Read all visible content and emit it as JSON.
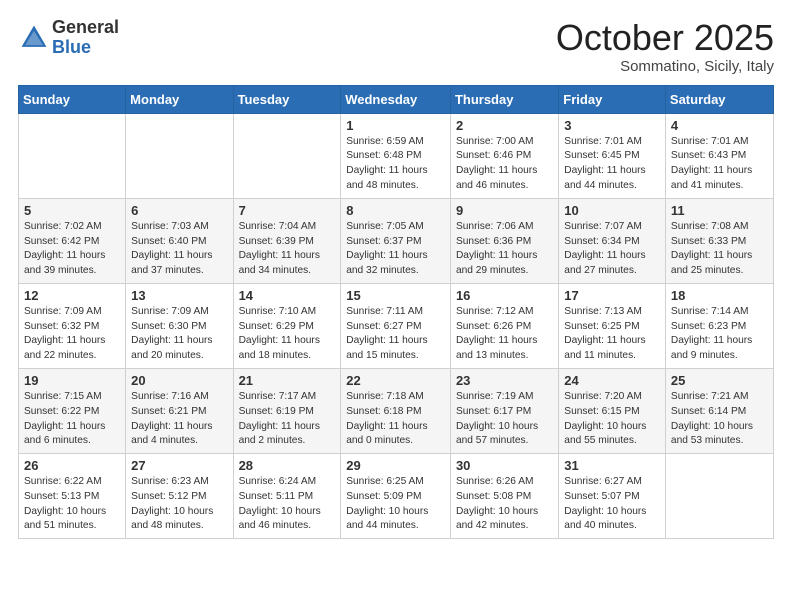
{
  "logo": {
    "general": "General",
    "blue": "Blue"
  },
  "header": {
    "month": "October 2025",
    "location": "Sommatino, Sicily, Italy"
  },
  "weekdays": [
    "Sunday",
    "Monday",
    "Tuesday",
    "Wednesday",
    "Thursday",
    "Friday",
    "Saturday"
  ],
  "weeks": [
    [
      {
        "day": "",
        "info": ""
      },
      {
        "day": "",
        "info": ""
      },
      {
        "day": "",
        "info": ""
      },
      {
        "day": "1",
        "info": "Sunrise: 6:59 AM\nSunset: 6:48 PM\nDaylight: 11 hours\nand 48 minutes."
      },
      {
        "day": "2",
        "info": "Sunrise: 7:00 AM\nSunset: 6:46 PM\nDaylight: 11 hours\nand 46 minutes."
      },
      {
        "day": "3",
        "info": "Sunrise: 7:01 AM\nSunset: 6:45 PM\nDaylight: 11 hours\nand 44 minutes."
      },
      {
        "day": "4",
        "info": "Sunrise: 7:01 AM\nSunset: 6:43 PM\nDaylight: 11 hours\nand 41 minutes."
      }
    ],
    [
      {
        "day": "5",
        "info": "Sunrise: 7:02 AM\nSunset: 6:42 PM\nDaylight: 11 hours\nand 39 minutes."
      },
      {
        "day": "6",
        "info": "Sunrise: 7:03 AM\nSunset: 6:40 PM\nDaylight: 11 hours\nand 37 minutes."
      },
      {
        "day": "7",
        "info": "Sunrise: 7:04 AM\nSunset: 6:39 PM\nDaylight: 11 hours\nand 34 minutes."
      },
      {
        "day": "8",
        "info": "Sunrise: 7:05 AM\nSunset: 6:37 PM\nDaylight: 11 hours\nand 32 minutes."
      },
      {
        "day": "9",
        "info": "Sunrise: 7:06 AM\nSunset: 6:36 PM\nDaylight: 11 hours\nand 29 minutes."
      },
      {
        "day": "10",
        "info": "Sunrise: 7:07 AM\nSunset: 6:34 PM\nDaylight: 11 hours\nand 27 minutes."
      },
      {
        "day": "11",
        "info": "Sunrise: 7:08 AM\nSunset: 6:33 PM\nDaylight: 11 hours\nand 25 minutes."
      }
    ],
    [
      {
        "day": "12",
        "info": "Sunrise: 7:09 AM\nSunset: 6:32 PM\nDaylight: 11 hours\nand 22 minutes."
      },
      {
        "day": "13",
        "info": "Sunrise: 7:09 AM\nSunset: 6:30 PM\nDaylight: 11 hours\nand 20 minutes."
      },
      {
        "day": "14",
        "info": "Sunrise: 7:10 AM\nSunset: 6:29 PM\nDaylight: 11 hours\nand 18 minutes."
      },
      {
        "day": "15",
        "info": "Sunrise: 7:11 AM\nSunset: 6:27 PM\nDaylight: 11 hours\nand 15 minutes."
      },
      {
        "day": "16",
        "info": "Sunrise: 7:12 AM\nSunset: 6:26 PM\nDaylight: 11 hours\nand 13 minutes."
      },
      {
        "day": "17",
        "info": "Sunrise: 7:13 AM\nSunset: 6:25 PM\nDaylight: 11 hours\nand 11 minutes."
      },
      {
        "day": "18",
        "info": "Sunrise: 7:14 AM\nSunset: 6:23 PM\nDaylight: 11 hours\nand 9 minutes."
      }
    ],
    [
      {
        "day": "19",
        "info": "Sunrise: 7:15 AM\nSunset: 6:22 PM\nDaylight: 11 hours\nand 6 minutes."
      },
      {
        "day": "20",
        "info": "Sunrise: 7:16 AM\nSunset: 6:21 PM\nDaylight: 11 hours\nand 4 minutes."
      },
      {
        "day": "21",
        "info": "Sunrise: 7:17 AM\nSunset: 6:19 PM\nDaylight: 11 hours\nand 2 minutes."
      },
      {
        "day": "22",
        "info": "Sunrise: 7:18 AM\nSunset: 6:18 PM\nDaylight: 11 hours\nand 0 minutes."
      },
      {
        "day": "23",
        "info": "Sunrise: 7:19 AM\nSunset: 6:17 PM\nDaylight: 10 hours\nand 57 minutes."
      },
      {
        "day": "24",
        "info": "Sunrise: 7:20 AM\nSunset: 6:15 PM\nDaylight: 10 hours\nand 55 minutes."
      },
      {
        "day": "25",
        "info": "Sunrise: 7:21 AM\nSunset: 6:14 PM\nDaylight: 10 hours\nand 53 minutes."
      }
    ],
    [
      {
        "day": "26",
        "info": "Sunrise: 6:22 AM\nSunset: 5:13 PM\nDaylight: 10 hours\nand 51 minutes."
      },
      {
        "day": "27",
        "info": "Sunrise: 6:23 AM\nSunset: 5:12 PM\nDaylight: 10 hours\nand 48 minutes."
      },
      {
        "day": "28",
        "info": "Sunrise: 6:24 AM\nSunset: 5:11 PM\nDaylight: 10 hours\nand 46 minutes."
      },
      {
        "day": "29",
        "info": "Sunrise: 6:25 AM\nSunset: 5:09 PM\nDaylight: 10 hours\nand 44 minutes."
      },
      {
        "day": "30",
        "info": "Sunrise: 6:26 AM\nSunset: 5:08 PM\nDaylight: 10 hours\nand 42 minutes."
      },
      {
        "day": "31",
        "info": "Sunrise: 6:27 AM\nSunset: 5:07 PM\nDaylight: 10 hours\nand 40 minutes."
      },
      {
        "day": "",
        "info": ""
      }
    ]
  ]
}
